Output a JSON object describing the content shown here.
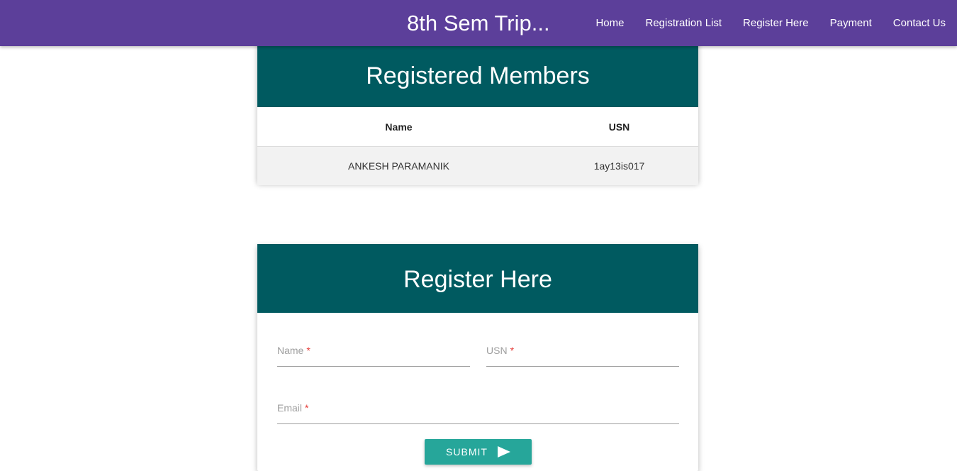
{
  "navbar": {
    "brand": "8th Sem Trip...",
    "links": [
      "Home",
      "Registration List",
      "Register Here",
      "Payment",
      "Contact Us"
    ],
    "color": "#5c3f9a"
  },
  "members": {
    "title": "Registered Members",
    "columns": [
      "Name",
      "USN"
    ],
    "rows": [
      [
        "ANKESH PARAMANIK",
        "1ay13is017"
      ]
    ],
    "header_color": "#005a60"
  },
  "register": {
    "title": "Register Here",
    "fields": {
      "name": {
        "label": "Name",
        "required_mark": "*",
        "value": ""
      },
      "usn": {
        "label": "USN",
        "required_mark": "*",
        "value": ""
      },
      "email": {
        "label": "Email",
        "required_mark": "*",
        "value": ""
      }
    },
    "submit_label": "SUBMIT",
    "submit_icon": "send-icon",
    "button_color": "#26a69a"
  }
}
